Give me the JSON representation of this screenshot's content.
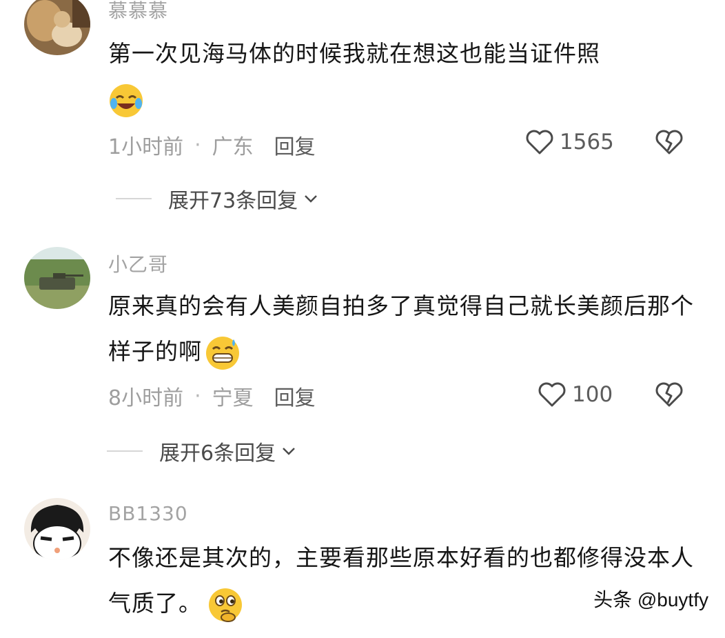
{
  "comments": [
    {
      "username": "慕慕慕",
      "text": "第一次见海马体的时候我就在想这也能当证件照",
      "emoji": "laughing-tears-emoji",
      "time": "1小时前",
      "location": "广东",
      "reply_label": "回复",
      "likes": "1565",
      "expand_label": "展开73条回复"
    },
    {
      "username": "小乙哥",
      "text": "原来真的会有人美颜自拍多了真觉得自己就长美颜后那个样子的啊",
      "emoji": "grinning-sweat-emoji",
      "time": "8小时前",
      "location": "宁夏",
      "reply_label": "回复",
      "likes": "100",
      "expand_label": "展开6条回复"
    },
    {
      "username": "BB1330",
      "text": "不像还是其次的，主要看那些原本好看的也都修得没本人气质了。",
      "emoji": "thinking-emoji"
    }
  ],
  "watermark": "头条 @buytfy",
  "colors": {
    "username": "#a3a3a3",
    "text": "#161616",
    "meta": "#9e9e9e",
    "emoji_yellow": "#f8c836"
  }
}
